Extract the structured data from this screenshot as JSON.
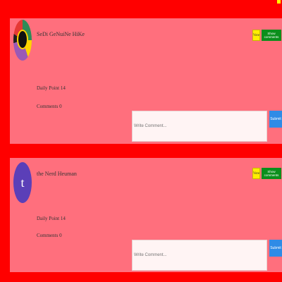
{
  "posts": [
    {
      "username": "SeDi GeNuiNe HiKe",
      "avatar": "profile-photo",
      "vote_label": "Vote",
      "show_comments_label": "Show comments",
      "daily_point": "Daily Point 14",
      "comments_count": "Comments 0",
      "comment_placeholder": "Write Comment...",
      "submit_label": "Submit"
    },
    {
      "username": "the Nerd Heuman",
      "avatar_letter": "t",
      "vote_label": "Vote",
      "show_comments_label": "Show comments",
      "daily_point": "Daily Point 14",
      "comments_count": "Comments 0",
      "comment_placeholder": "Write Comment...",
      "submit_label": "Submit"
    }
  ],
  "colors": {
    "page_background": "#ff0000",
    "card_background": "#ff6f7d",
    "show_comments_button": "#0b8f1c",
    "submit_button": "#2f8be6",
    "vote_badge": "#ffef00",
    "avatar_letter_background": "#5b3fb8"
  }
}
